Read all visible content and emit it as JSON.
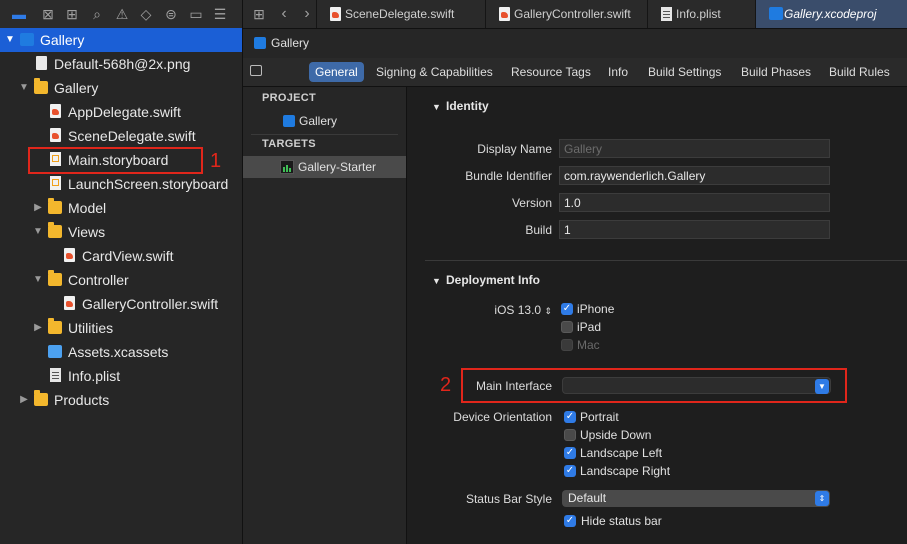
{
  "navigator": {
    "toolbar_icons": [
      "folder-icon",
      "source-control-icon",
      "symbol-icon",
      "search-icon",
      "warning-icon",
      "test-icon",
      "debug-icon",
      "breakpoint-icon",
      "report-icon"
    ],
    "items": [
      {
        "label": "Gallery",
        "kind": "project",
        "depth": 0,
        "disclosure": "open",
        "selected": true
      },
      {
        "label": "Default-568h@2x.png",
        "kind": "file",
        "depth": 1,
        "disclosure": "none"
      },
      {
        "label": "Gallery",
        "kind": "folder",
        "depth": 1,
        "disclosure": "open"
      },
      {
        "label": "AppDelegate.swift",
        "kind": "swift",
        "depth": 2,
        "disclosure": "none"
      },
      {
        "label": "SceneDelegate.swift",
        "kind": "swift",
        "depth": 2,
        "disclosure": "none"
      },
      {
        "label": "Main.storyboard",
        "kind": "storyboard",
        "depth": 2,
        "disclosure": "none"
      },
      {
        "label": "LaunchScreen.storyboard",
        "kind": "storyboard",
        "depth": 2,
        "disclosure": "none"
      },
      {
        "label": "Model",
        "kind": "folder",
        "depth": 2,
        "disclosure": "closed"
      },
      {
        "label": "Views",
        "kind": "folder",
        "depth": 2,
        "disclosure": "open"
      },
      {
        "label": "CardView.swift",
        "kind": "swift",
        "depth": 3,
        "disclosure": "none"
      },
      {
        "label": "Controller",
        "kind": "folder",
        "depth": 2,
        "disclosure": "open"
      },
      {
        "label": "GalleryController.swift",
        "kind": "swift",
        "depth": 3,
        "disclosure": "none"
      },
      {
        "label": "Utilities",
        "kind": "folder",
        "depth": 2,
        "disclosure": "closed"
      },
      {
        "label": "Assets.xcassets",
        "kind": "assets",
        "depth": 2,
        "disclosure": "none"
      },
      {
        "label": "Info.plist",
        "kind": "plist",
        "depth": 2,
        "disclosure": "none"
      },
      {
        "label": "Products",
        "kind": "folder",
        "depth": 1,
        "disclosure": "closed"
      }
    ],
    "annotation_1": "1"
  },
  "tabs": [
    {
      "label": "SceneDelegate.swift",
      "kind": "swift",
      "active": false
    },
    {
      "label": "GalleryController.swift",
      "kind": "swift",
      "active": false
    },
    {
      "label": "Info.plist",
      "kind": "plist",
      "active": false
    },
    {
      "label": "Gallery.xcodeproj",
      "kind": "project",
      "active": true
    }
  ],
  "jumpbar": {
    "label": "Gallery"
  },
  "editor_tabs": [
    "General",
    "Signing & Capabilities",
    "Resource Tags",
    "Info",
    "Build Settings",
    "Build Phases",
    "Build Rules"
  ],
  "editor_tabs_active": "General",
  "targets_panel": {
    "project_header": "PROJECT",
    "project_item": "Gallery",
    "targets_header": "TARGETS",
    "target_item": "Gallery-Starter"
  },
  "identity": {
    "header": "Identity",
    "display_name_label": "Display Name",
    "display_name_placeholder": "Gallery",
    "bundle_id_label": "Bundle Identifier",
    "bundle_id_value": "com.raywenderlich.Gallery",
    "version_label": "Version",
    "version_value": "1.0",
    "build_label": "Build",
    "build_value": "1"
  },
  "deployment": {
    "header": "Deployment Info",
    "ios_label": "iOS 13.0",
    "devices": [
      {
        "label": "iPhone",
        "state": "checked"
      },
      {
        "label": "iPad",
        "state": "unchecked"
      },
      {
        "label": "Mac",
        "state": "disabled"
      }
    ],
    "main_interface_label": "Main Interface",
    "main_interface_value": "",
    "annotation_2": "2",
    "orientation_label": "Device Orientation",
    "orientations": [
      {
        "label": "Portrait",
        "state": "checked"
      },
      {
        "label": "Upside Down",
        "state": "unchecked"
      },
      {
        "label": "Landscape Left",
        "state": "checked"
      },
      {
        "label": "Landscape Right",
        "state": "checked"
      }
    ],
    "status_bar_label": "Status Bar Style",
    "status_bar_value": "Default",
    "hide_status_bar_label": "Hide status bar",
    "hide_status_bar_state": "checked"
  },
  "colors": {
    "accent": "#2f7be6",
    "selection": "#1b5fd6",
    "annotation": "#e0261b",
    "folder": "#f3b72d"
  }
}
